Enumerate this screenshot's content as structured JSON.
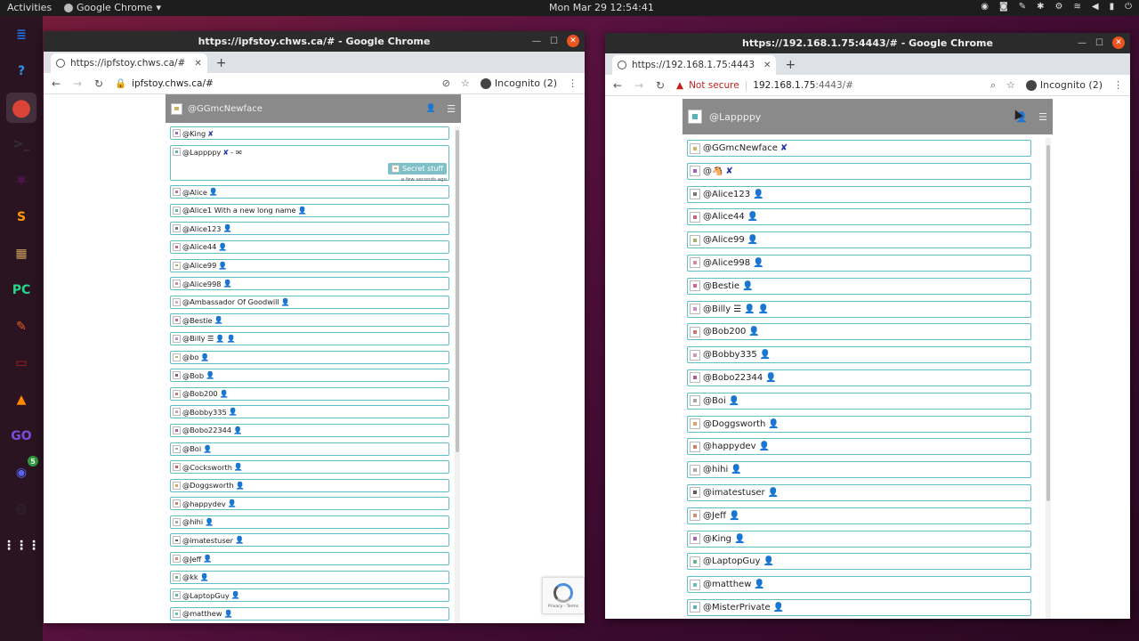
{
  "topbar": {
    "activities": "Activities",
    "app_name": "Google Chrome",
    "clock": "Mon Mar 29  12:54:41"
  },
  "dock": {
    "items": [
      {
        "icon": "files-icon",
        "glyph": "≣",
        "color": "#1e6fd9"
      },
      {
        "icon": "help-icon",
        "glyph": "?",
        "color": "#2f8fe0"
      },
      {
        "icon": "chrome-icon",
        "glyph": "●",
        "color": "#db4437"
      },
      {
        "icon": "terminal-icon",
        "glyph": ">_",
        "color": "#333333"
      },
      {
        "icon": "slack-icon",
        "glyph": "✱",
        "color": "#4a154b"
      },
      {
        "icon": "sublime-icon",
        "glyph": "S",
        "color": "#ff9800"
      },
      {
        "icon": "archive-icon",
        "glyph": "▦",
        "color": "#c9a05a"
      },
      {
        "icon": "pycharm-icon",
        "glyph": "PC",
        "color": "#21d789"
      },
      {
        "icon": "postman-icon",
        "glyph": "✎",
        "color": "#ef5b25"
      },
      {
        "icon": "remote-icon",
        "glyph": "▭",
        "color": "#b71c1c"
      },
      {
        "icon": "vlc-icon",
        "glyph": "▲",
        "color": "#ff8800"
      },
      {
        "icon": "goland-icon",
        "glyph": "GO",
        "color": "#7b4bd8"
      },
      {
        "icon": "discord-icon",
        "glyph": "◉",
        "color": "#5865f2",
        "badge": "5"
      },
      {
        "icon": "obs-icon",
        "glyph": "◎",
        "color": "#302e31"
      },
      {
        "icon": "apps-grid-icon",
        "glyph": "⋮⋮⋮",
        "color": "#2a1422"
      }
    ]
  },
  "left_window": {
    "title": "https://ipfstoy.chws.ca/# - Google Chrome",
    "tab_label": "https://ipfstoy.chws.ca/#",
    "url": "ipfstoy.chws.ca/#",
    "incognito": "Incognito (2)",
    "app": {
      "current_user": "@GGmcNewface",
      "expanded": {
        "name": "@Lappppy",
        "suffix": " - ✉",
        "message": "Secret stuff",
        "time": "a few seconds ago"
      },
      "rows": [
        {
          "name": "@King",
          "mark": "x",
          "color": "#8a3fb0"
        },
        {
          "name": "@Alice",
          "mark": "p",
          "color": "#b04a8a"
        },
        {
          "name": "@Alice1 With a new long name",
          "mark": "p",
          "color": "#3fa07a"
        },
        {
          "name": "@Alice123",
          "mark": "p",
          "color": "#555555"
        },
        {
          "name": "@Alice44",
          "mark": "p",
          "color": "#c43a55"
        },
        {
          "name": "@Alice99",
          "mark": "p",
          "color": "#8aa040"
        },
        {
          "name": "@Alice998",
          "mark": "p",
          "color": "#c07080"
        },
        {
          "name": "@Ambassador Of Goodwill",
          "mark": "p",
          "color": "#d090b0"
        },
        {
          "name": "@Bestie",
          "mark": "p",
          "color": "#c04070"
        },
        {
          "name": "@Billy ☰",
          "mark": "pp",
          "color": "#c070c0"
        },
        {
          "name": "@bo",
          "mark": "p",
          "color": "#a0a040"
        },
        {
          "name": "@Bob",
          "mark": "p",
          "color": "#703030"
        },
        {
          "name": "@Bob200",
          "mark": "p",
          "color": "#c05050"
        },
        {
          "name": "@Bobby335",
          "mark": "p",
          "color": "#c080a0"
        },
        {
          "name": "@Bobo22344",
          "mark": "p",
          "color": "#a03080"
        },
        {
          "name": "@Boi",
          "mark": "p",
          "color": "#909090"
        },
        {
          "name": "@Cocksworth",
          "mark": "p",
          "color": "#c03030"
        },
        {
          "name": "@Doggsworth",
          "mark": "p",
          "color": "#d09040"
        },
        {
          "name": "@happydev",
          "mark": "p",
          "color": "#c06040"
        },
        {
          "name": "@hihi",
          "mark": "p",
          "color": "#909090"
        },
        {
          "name": "@imatestuser",
          "mark": "p",
          "color": "#333333"
        },
        {
          "name": "@Jeff",
          "mark": "p",
          "color": "#d07050"
        },
        {
          "name": "@kk",
          "mark": "p",
          "color": "#40a060"
        },
        {
          "name": "@LaptopGuy",
          "mark": "p",
          "color": "#40a070"
        },
        {
          "name": "@matthew",
          "mark": "p",
          "color": "#40b0a0"
        }
      ]
    },
    "recaptcha_text": "Privacy - Terms"
  },
  "right_window": {
    "title": "https://192.168.1.75:4443/# - Google Chrome",
    "tab_label": "https://192.168.1.75:4443",
    "not_secure": "Not secure",
    "url_host": "192.168.1.75",
    "url_rest": ":4443/#",
    "incognito": "Incognito (2)",
    "app": {
      "current_user": "@Lappppy",
      "rows": [
        {
          "name": "@GGmcNewface",
          "mark": "x",
          "color": "#c0a040"
        },
        {
          "name": "@🐴",
          "mark": "x",
          "color": "#8a3fb0"
        },
        {
          "name": "@Alice123",
          "mark": "p",
          "color": "#555555"
        },
        {
          "name": "@Alice44",
          "mark": "p",
          "color": "#c43a55"
        },
        {
          "name": "@Alice99",
          "mark": "p",
          "color": "#8aa040"
        },
        {
          "name": "@Alice998",
          "mark": "p",
          "color": "#c07080"
        },
        {
          "name": "@Bestie",
          "mark": "p",
          "color": "#c04070"
        },
        {
          "name": "@Billy ☰",
          "mark": "pp",
          "color": "#c070c0"
        },
        {
          "name": "@Bob200",
          "mark": "p",
          "color": "#c05050"
        },
        {
          "name": "@Bobby335",
          "mark": "p",
          "color": "#c080a0"
        },
        {
          "name": "@Bobo22344",
          "mark": "p",
          "color": "#a03080"
        },
        {
          "name": "@Boi",
          "mark": "p",
          "color": "#909090"
        },
        {
          "name": "@Doggsworth",
          "mark": "p",
          "color": "#d09040"
        },
        {
          "name": "@happydev",
          "mark": "p",
          "color": "#c06040"
        },
        {
          "name": "@hihi",
          "mark": "p",
          "color": "#909090"
        },
        {
          "name": "@imatestuser",
          "mark": "p",
          "color": "#333333"
        },
        {
          "name": "@Jeff",
          "mark": "p",
          "color": "#d07050"
        },
        {
          "name": "@King",
          "mark": "p",
          "color": "#8a3fb0"
        },
        {
          "name": "@LaptopGuy",
          "mark": "p",
          "color": "#40a070"
        },
        {
          "name": "@matthew",
          "mark": "p",
          "color": "#40b0a0"
        },
        {
          "name": "@MisterPrivate",
          "mark": "p",
          "color": "#30a0a0"
        }
      ]
    }
  }
}
